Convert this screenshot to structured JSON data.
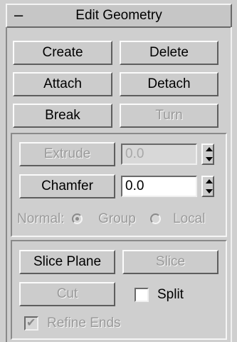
{
  "rollout": {
    "collapse_symbol": "–",
    "title": "Edit Geometry"
  },
  "buttons": {
    "create": "Create",
    "delete": "Delete",
    "attach": "Attach",
    "detach": "Detach",
    "break": "Break",
    "turn": "Turn",
    "extrude": "Extrude",
    "chamfer": "Chamfer",
    "slice_plane": "Slice Plane",
    "slice": "Slice",
    "cut": "Cut"
  },
  "extrude_value": "0.0",
  "chamfer_value": "0.0",
  "normal": {
    "label": "Normal:",
    "group_label": "Group",
    "local_label": "Local",
    "selected": "Group"
  },
  "split": {
    "label": "Split",
    "checked": false
  },
  "refine_ends": {
    "label": "Refine Ends",
    "checked": true,
    "enabled": false
  }
}
